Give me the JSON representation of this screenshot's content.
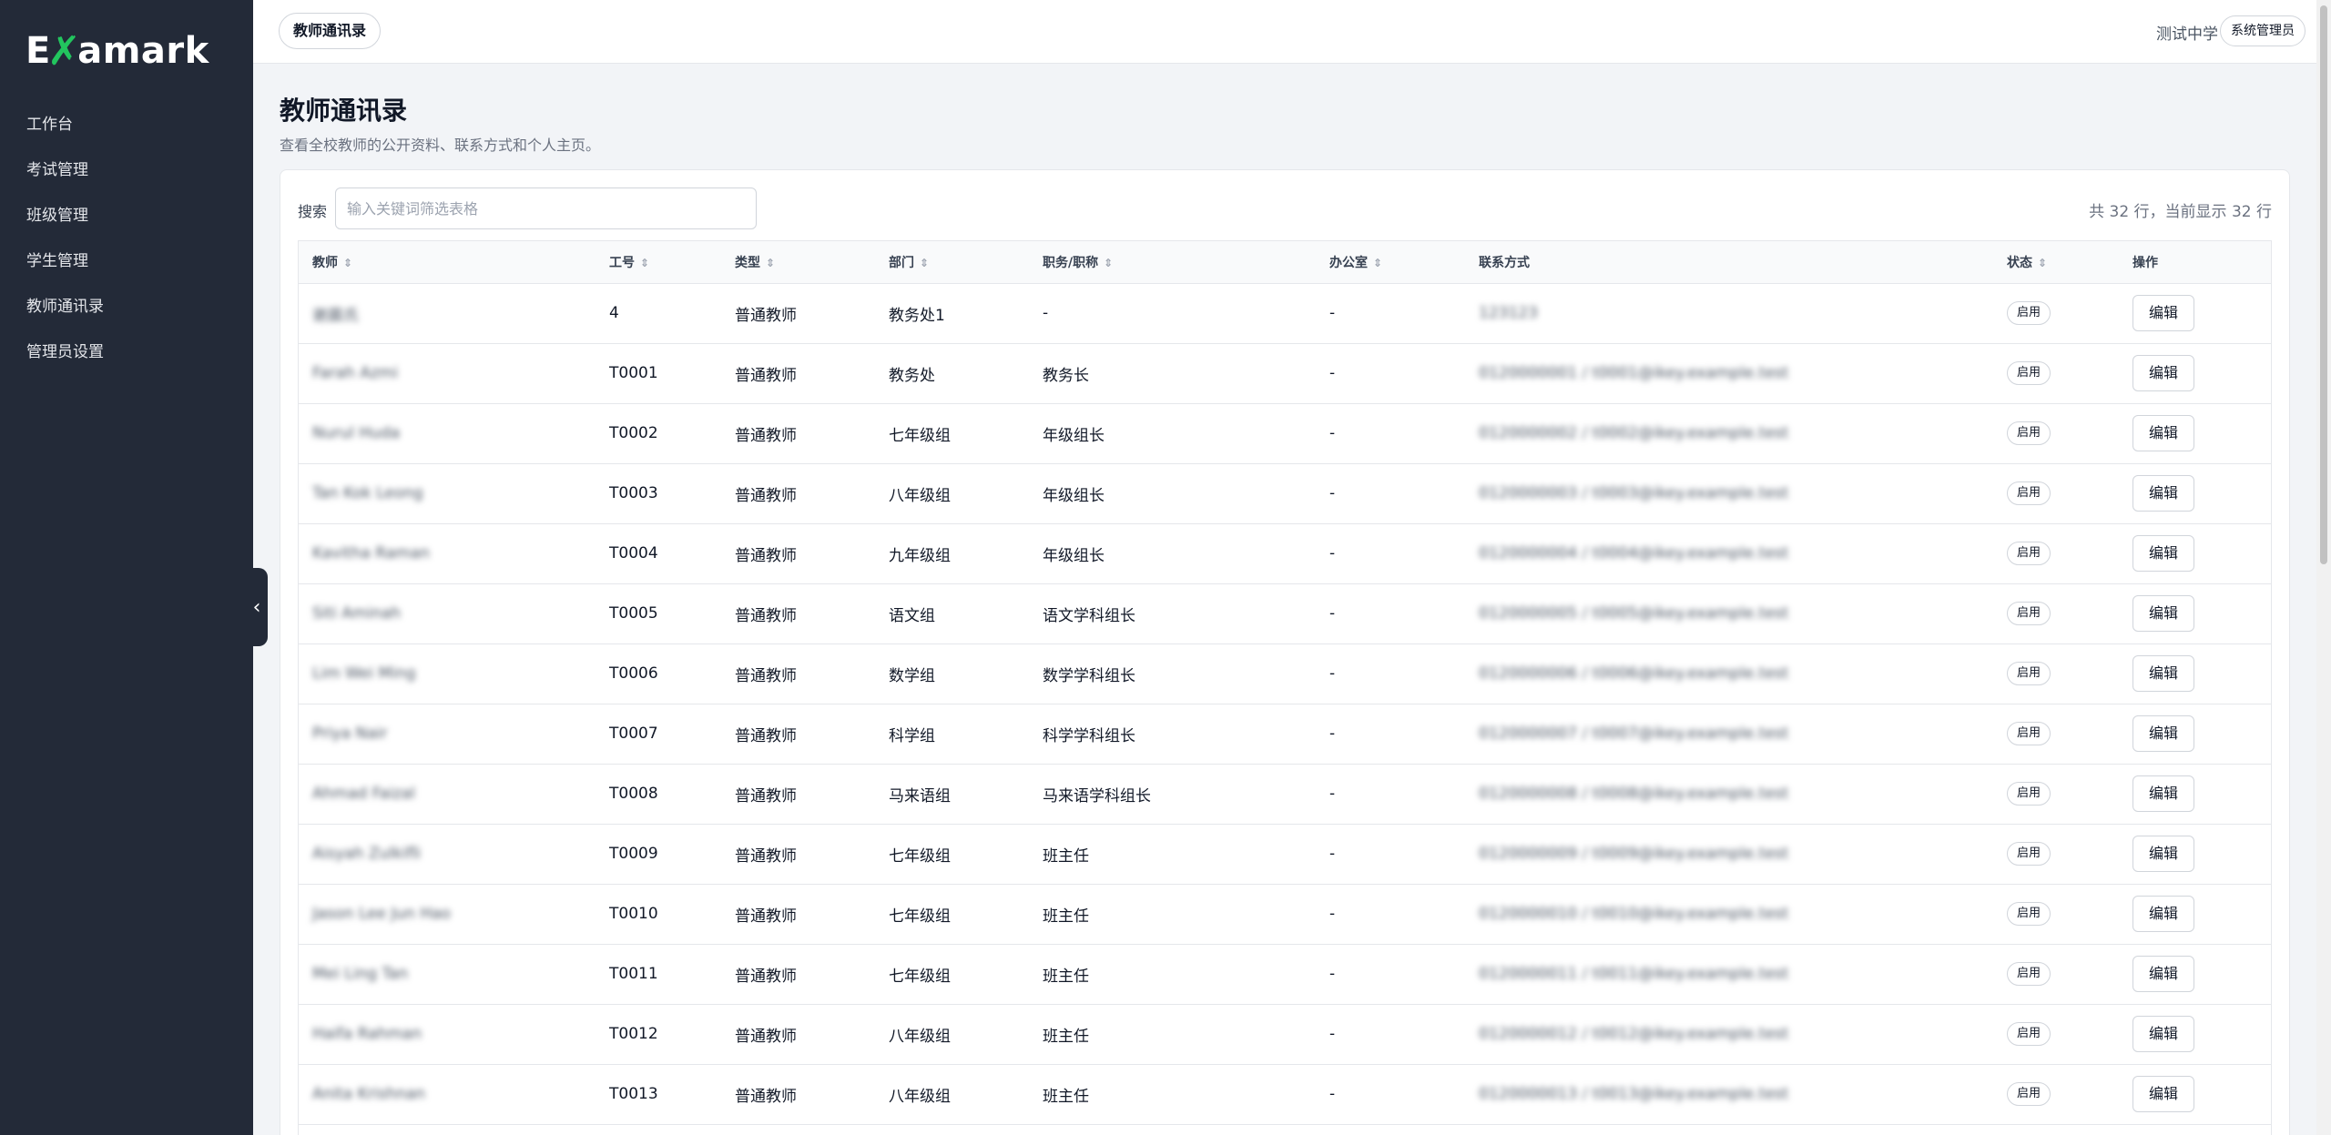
{
  "app": {
    "logo_text_pre": "E",
    "logo_text_post": "amark",
    "brand_color": "#22c55e"
  },
  "sidebar": {
    "items": [
      {
        "label": "工作台"
      },
      {
        "label": "考试管理"
      },
      {
        "label": "班级管理"
      },
      {
        "label": "学生管理"
      },
      {
        "label": "教师通讯录"
      },
      {
        "label": "管理员设置"
      }
    ],
    "collapse_icon": "‹"
  },
  "topbar": {
    "tab_label": "教师通讯录",
    "org_name": "测试中学",
    "role_label": "系统管理员"
  },
  "page": {
    "title": "教师通讯录",
    "subtitle": "查看全校教师的公开资料、联系方式和个人主页。"
  },
  "search": {
    "label": "搜索",
    "placeholder": "输入关键词筛选表格",
    "value": ""
  },
  "summary": {
    "row_count_text": "共 32 行，当前显示 32 行"
  },
  "table": {
    "columns": [
      {
        "label": "教师",
        "sortable": true
      },
      {
        "label": "工号",
        "sortable": true
      },
      {
        "label": "类型",
        "sortable": true
      },
      {
        "label": "部门",
        "sortable": true
      },
      {
        "label": "职务/职称",
        "sortable": true
      },
      {
        "label": "办公室",
        "sortable": true
      },
      {
        "label": "联系方式",
        "sortable": false
      },
      {
        "label": "状态",
        "sortable": true
      },
      {
        "label": "操作",
        "sortable": false
      }
    ],
    "sort_icon": "⇕",
    "edit_label": "编辑",
    "status_label": "启用",
    "rows": [
      {
        "name": "谢晨氏",
        "id": "4",
        "type": "普通教师",
        "dept": "教务处1",
        "title": "-",
        "office": "-",
        "contact": "123123"
      },
      {
        "name": "Farah Azmi",
        "id": "T0001",
        "type": "普通教师",
        "dept": "教务处",
        "title": "教务长",
        "office": "-",
        "contact": "0120000001 / t0001@ikey.example.test"
      },
      {
        "name": "Nurul Huda",
        "id": "T0002",
        "type": "普通教师",
        "dept": "七年级组",
        "title": "年级组长",
        "office": "-",
        "contact": "0120000002 / t0002@ikey.example.test"
      },
      {
        "name": "Tan Kok Leong",
        "id": "T0003",
        "type": "普通教师",
        "dept": "八年级组",
        "title": "年级组长",
        "office": "-",
        "contact": "0120000003 / t0003@ikey.example.test"
      },
      {
        "name": "Kavitha Raman",
        "id": "T0004",
        "type": "普通教师",
        "dept": "九年级组",
        "title": "年级组长",
        "office": "-",
        "contact": "0120000004 / t0004@ikey.example.test"
      },
      {
        "name": "Siti Aminah",
        "id": "T0005",
        "type": "普通教师",
        "dept": "语文组",
        "title": "语文学科组长",
        "office": "-",
        "contact": "0120000005 / t0005@ikey.example.test"
      },
      {
        "name": "Lim Wei Ming",
        "id": "T0006",
        "type": "普通教师",
        "dept": "数学组",
        "title": "数学学科组长",
        "office": "-",
        "contact": "0120000006 / t0006@ikey.example.test"
      },
      {
        "name": "Priya Nair",
        "id": "T0007",
        "type": "普通教师",
        "dept": "科学组",
        "title": "科学学科组长",
        "office": "-",
        "contact": "0120000007 / t0007@ikey.example.test"
      },
      {
        "name": "Ahmad Faizal",
        "id": "T0008",
        "type": "普通教师",
        "dept": "马来语组",
        "title": "马来语学科组长",
        "office": "-",
        "contact": "0120000008 / t0008@ikey.example.test"
      },
      {
        "name": "Aisyah Zulkifli",
        "id": "T0009",
        "type": "普通教师",
        "dept": "七年级组",
        "title": "班主任",
        "office": "-",
        "contact": "0120000009 / t0009@ikey.example.test"
      },
      {
        "name": "Jason Lee Jun Hao",
        "id": "T0010",
        "type": "普通教师",
        "dept": "七年级组",
        "title": "班主任",
        "office": "-",
        "contact": "0120000010 / t0010@ikey.example.test"
      },
      {
        "name": "Mei Ling Tan",
        "id": "T0011",
        "type": "普通教师",
        "dept": "七年级组",
        "title": "班主任",
        "office": "-",
        "contact": "0120000011 / t0011@ikey.example.test"
      },
      {
        "name": "Haifa Rahman",
        "id": "T0012",
        "type": "普通教师",
        "dept": "八年级组",
        "title": "班主任",
        "office": "-",
        "contact": "0120000012 / t0012@ikey.example.test"
      },
      {
        "name": "Anita Krishnan",
        "id": "T0013",
        "type": "普通教师",
        "dept": "八年级组",
        "title": "班主任",
        "office": "-",
        "contact": "0120000013 / t0013@ikey.example.test"
      },
      {
        "name": "",
        "id": "",
        "type": "",
        "dept": "",
        "title": "",
        "office": "",
        "contact": ""
      }
    ]
  }
}
